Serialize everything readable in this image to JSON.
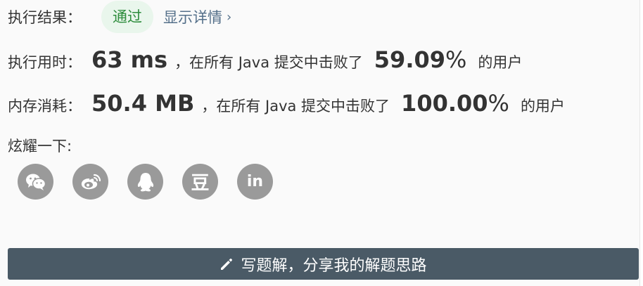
{
  "result": {
    "label": "执行结果：",
    "status": "通过",
    "details_link": "显示详情",
    "chevron": "›"
  },
  "runtime": {
    "label": "执行用时：",
    "value": "63 ms",
    "middle_text": "，在所有 Java 提交中击败了",
    "percent_number": "59.09",
    "percent_symbol": "%",
    "suffix": "的用户"
  },
  "memory": {
    "label": "内存消耗：",
    "value": "50.4 MB",
    "middle_text": "，在所有 Java 提交中击败了",
    "percent_number": "100.00",
    "percent_symbol": "%",
    "suffix": "的用户"
  },
  "share": {
    "label": "炫耀一下:",
    "icons": [
      "wechat-icon",
      "weibo-icon",
      "qq-icon",
      "douban-icon",
      "linkedin-icon"
    ],
    "douban_glyph": "豆",
    "linkedin_glyph": "in"
  },
  "write_solution_button": {
    "label": "写题解，分享我的解题思路",
    "icon": "pencil-icon"
  },
  "colors": {
    "status_text": "#2d8c3c",
    "status_bg": "#e9f6ec",
    "link": "#55708a",
    "icon_bg": "#9a9a9a",
    "button_bg": "#4a5a66"
  }
}
